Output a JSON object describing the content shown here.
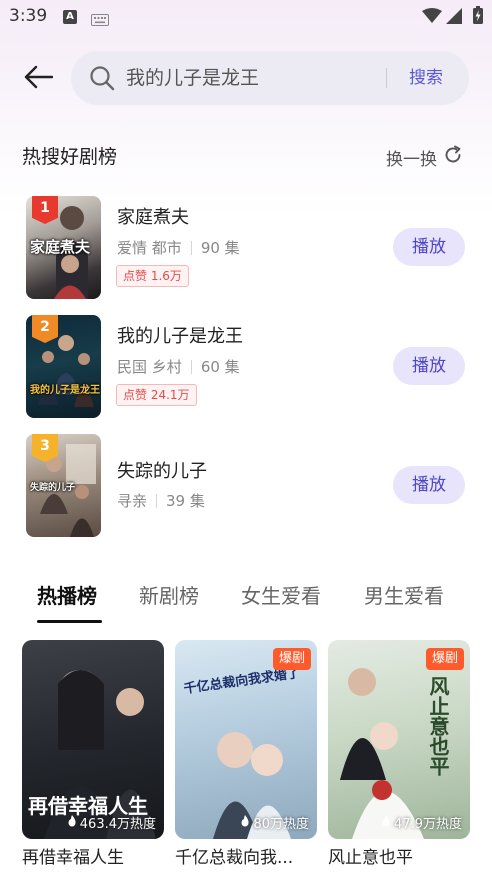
{
  "status_bar": {
    "time": "3:39",
    "a_icon_label": "A"
  },
  "search": {
    "query": "我的儿子是龙王",
    "submit_label": "搜索"
  },
  "hot_section": {
    "title": "热搜好剧榜",
    "refresh_label": "换一换",
    "items": [
      {
        "rank": "1",
        "title": "家庭煮夫",
        "tags": [
          "爱情",
          "都市"
        ],
        "episodes": "90 集",
        "likes": "点赞 1.6万",
        "play_label": "播放",
        "cover_caption": "家庭煮夫",
        "badge_color": "#e8392f"
      },
      {
        "rank": "2",
        "title": "我的儿子是龙王",
        "tags": [
          "民国",
          "乡村"
        ],
        "episodes": "60 集",
        "likes": "点赞 24.1万",
        "play_label": "播放",
        "cover_caption": "我的儿子是龙王",
        "badge_color": "#f08a24"
      },
      {
        "rank": "3",
        "title": "失踪的儿子",
        "tags": [
          "寻亲"
        ],
        "episodes": "39 集",
        "likes": "",
        "play_label": "播放",
        "cover_caption": "失踪的儿子",
        "badge_color": "#f5b22a"
      }
    ]
  },
  "tabs": [
    {
      "label": "热播榜",
      "active": true
    },
    {
      "label": "新剧榜",
      "active": false
    },
    {
      "label": "女生爱看",
      "active": false
    },
    {
      "label": "男生爱看",
      "active": false
    }
  ],
  "cards": [
    {
      "title": "再借幸福人生",
      "heat": "463.4万热度",
      "tag": "",
      "cover_text": "再借幸福人生"
    },
    {
      "title": "千亿总裁向我...",
      "heat": "80万热度",
      "tag": "爆剧",
      "cover_text": "千亿总裁向我求婚了"
    },
    {
      "title": "风止意也平",
      "heat": "47.9万热度",
      "tag": "爆剧",
      "cover_text": "风止意也平"
    }
  ],
  "colors": {
    "accent": "#5a57d6",
    "play_button_bg": "#e7e4fb",
    "likes_red": "#e84a4a",
    "hot_tag": "#ff5a2b"
  }
}
